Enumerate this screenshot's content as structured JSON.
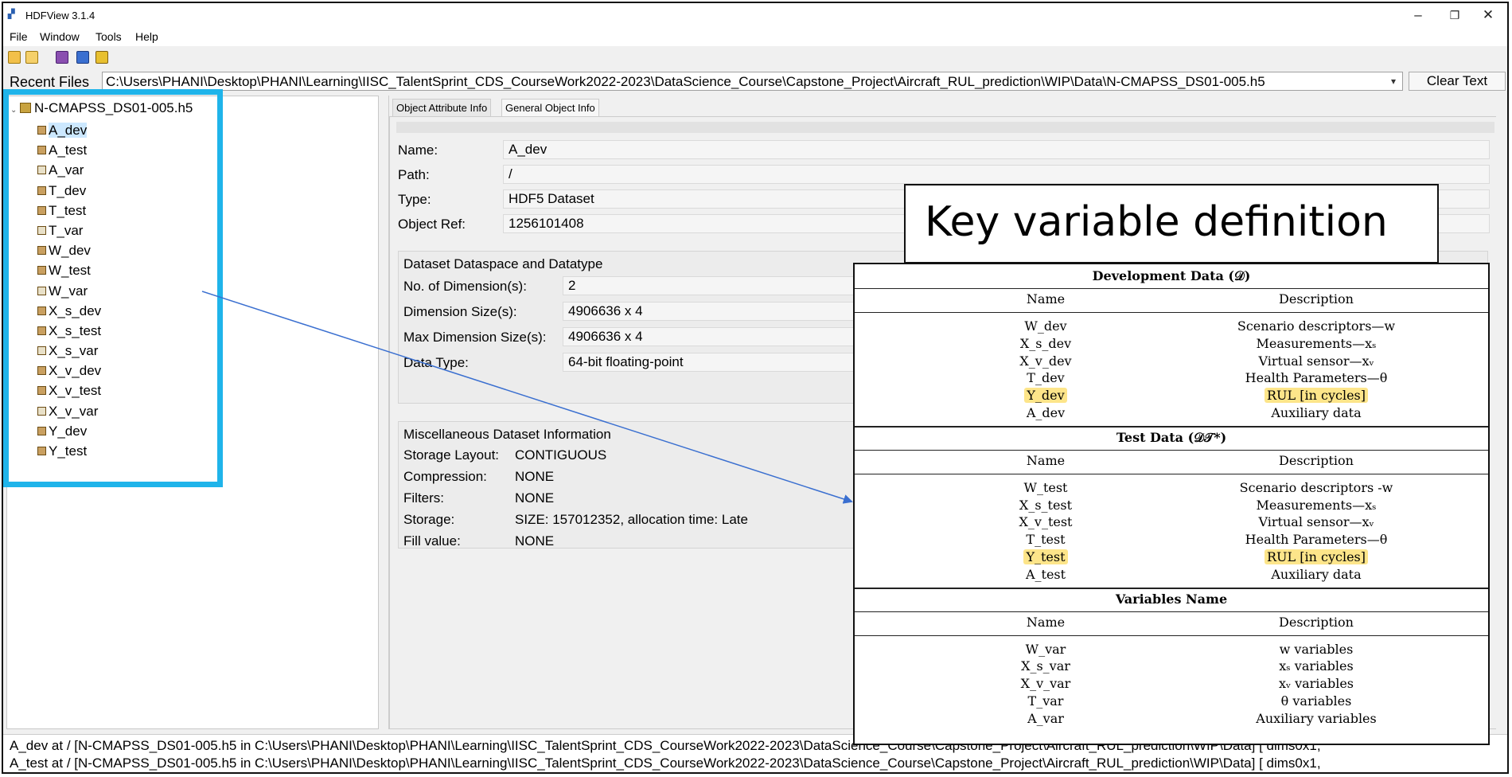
{
  "window": {
    "title": "HDFView 3.1.4",
    "minimize": "–",
    "maximize": "❐",
    "close": "✕"
  },
  "menu": [
    "File",
    "Window",
    "Tools",
    "Help"
  ],
  "recent": {
    "label": "Recent Files",
    "path": "C:\\Users\\PHANI\\Desktop\\PHANI\\Learning\\IISC_TalentSprint_CDS_CourseWork2022-2023\\DataScience_Course\\Capstone_Project\\Aircraft_RUL_prediction\\WIP\\Data\\N-CMAPSS_DS01-005.h5",
    "clear_label": "Clear Text"
  },
  "tree": {
    "root": "N-CMAPSS_DS01-005.h5",
    "items": [
      "A_dev",
      "A_test",
      "A_var",
      "T_dev",
      "T_test",
      "T_var",
      "W_dev",
      "W_test",
      "W_var",
      "X_s_dev",
      "X_s_test",
      "X_s_var",
      "X_v_dev",
      "X_v_test",
      "X_v_var",
      "Y_dev",
      "Y_test"
    ],
    "selected": "A_dev"
  },
  "tabs": [
    "Object Attribute Info",
    "General Object Info"
  ],
  "general": {
    "name_label": "Name:",
    "name_value": "A_dev",
    "path_label": "Path:",
    "path_value": "/",
    "type_label": "Type:",
    "type_value": "HDF5 Dataset",
    "ref_label": "Object Ref:",
    "ref_value": "1256101408"
  },
  "dataspace": {
    "title": "Dataset Dataspace and Datatype",
    "rows": [
      {
        "label": "No. of Dimension(s):",
        "value": "2"
      },
      {
        "label": "Dimension Size(s):",
        "value": "4906636 x 4"
      },
      {
        "label": "Max Dimension Size(s):",
        "value": "4906636 x 4"
      },
      {
        "label": "Data Type:",
        "value": "64-bit floating-point"
      }
    ]
  },
  "misc": {
    "title": "Miscellaneous Dataset Information",
    "rows": [
      {
        "label": "Storage Layout:",
        "value": "CONTIGUOUS"
      },
      {
        "label": "Compression:",
        "value": "NONE"
      },
      {
        "label": "Filters:",
        "value": "NONE"
      },
      {
        "label": "Storage:",
        "value": "SIZE: 157012352, allocation time: Late"
      },
      {
        "label": "Fill value:",
        "value": "NONE"
      }
    ]
  },
  "status": [
    "A_dev  at  /  [N-CMAPSS_DS01-005.h5  in  C:\\Users\\PHANI\\Desktop\\PHANI\\Learning\\IISC_TalentSprint_CDS_CourseWork2022-2023\\DataScience_Course\\Capstone_Project\\Aircraft_RUL_prediction\\WIP\\Data] [ dims0x1,",
    "A_test  at  /  [N-CMAPSS_DS01-005.h5  in  C:\\Users\\PHANI\\Desktop\\PHANI\\Learning\\IISC_TalentSprint_CDS_CourseWork2022-2023\\DataScience_Course\\Capstone_Project\\Aircraft_RUL_prediction\\WIP\\Data] [ dims0x1,"
  ],
  "callout": {
    "title": "Key variable definition",
    "col_name": "Name",
    "col_desc": "Description",
    "sections": [
      {
        "title": "Development Data (𝒟)",
        "rows": [
          {
            "name": "W_dev",
            "desc": "Scenario descriptors—w"
          },
          {
            "name": "X_s_dev",
            "desc": "Measurements—xₛ"
          },
          {
            "name": "X_v_dev",
            "desc": "Virtual sensor—xᵥ"
          },
          {
            "name": "T_dev",
            "desc": "Health Parameters—θ"
          },
          {
            "name": "Y_dev",
            "desc": "RUL [in cycles]"
          },
          {
            "name": "A_dev",
            "desc": "Auxiliary data"
          }
        ]
      },
      {
        "title": "Test Data (𝒟𝒯*)",
        "rows": [
          {
            "name": "W_test",
            "desc": "Scenario descriptors -w"
          },
          {
            "name": "X_s_test",
            "desc": "Measurements—xₛ"
          },
          {
            "name": "X_v_test",
            "desc": "Virtual sensor—xᵥ"
          },
          {
            "name": "T_test",
            "desc": "Health Parameters—θ"
          },
          {
            "name": "Y_test",
            "desc": "RUL [in cycles]"
          },
          {
            "name": "A_test",
            "desc": "Auxiliary data"
          }
        ]
      },
      {
        "title": "Variables Name",
        "rows": [
          {
            "name": "W_var",
            "desc": "w variables"
          },
          {
            "name": "X_s_var",
            "desc": "xₛ variables"
          },
          {
            "name": "X_v_var",
            "desc": "xᵥ variables"
          },
          {
            "name": "T_var",
            "desc": "θ variables"
          },
          {
            "name": "A_var",
            "desc": "Auxiliary variables"
          }
        ]
      }
    ]
  },
  "colors": {
    "highlight_border": "#1fb4ea",
    "arrow": "#3a6fd0",
    "row_highlight": "#fde58a"
  }
}
